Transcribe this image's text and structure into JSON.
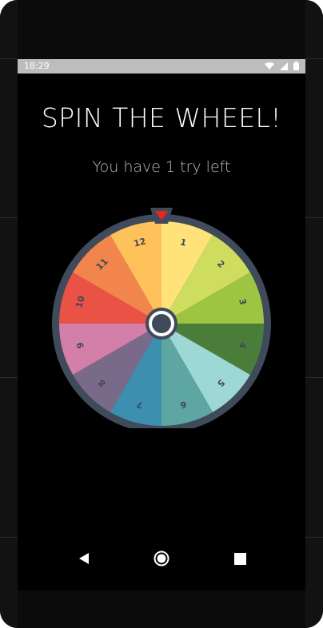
{
  "status_bar": {
    "time": "18:29",
    "icons": [
      "wifi-icon",
      "signal-icon",
      "battery-icon"
    ]
  },
  "title": "SPIN THE WHEEL!",
  "subtitle": "You have 1 try left",
  "wheel": {
    "segments": [
      {
        "label": "1",
        "color": "#FFE27A"
      },
      {
        "label": "2",
        "color": "#CFDD5F"
      },
      {
        "label": "3",
        "color": "#9DC541"
      },
      {
        "label": "4",
        "color": "#4B7D3A"
      },
      {
        "label": "5",
        "color": "#9ED8D4"
      },
      {
        "label": "6",
        "color": "#5EA6A2"
      },
      {
        "label": "7",
        "color": "#3C8FAF"
      },
      {
        "label": "8",
        "color": "#7A6A8A"
      },
      {
        "label": "9",
        "color": "#D37FA9"
      },
      {
        "label": "10",
        "color": "#EA5246"
      },
      {
        "label": "11",
        "color": "#F2854B"
      },
      {
        "label": "12",
        "color": "#FFC25B"
      }
    ],
    "rim_color": "#3F4A5A",
    "pointer_color": "#E82424"
  },
  "nav": {
    "back": "back-icon",
    "home": "home-icon",
    "recents": "recents-icon"
  }
}
